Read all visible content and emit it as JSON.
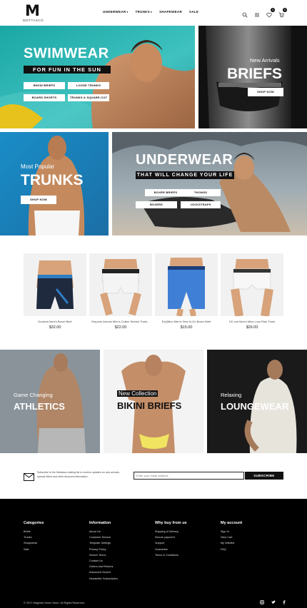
{
  "header": {
    "logo_mark": "M",
    "logo_name": "MOTTASCO",
    "nav": [
      {
        "label": "UNDERWEAR",
        "caret": "▾"
      },
      {
        "label": "TRUNKS",
        "caret": "▾"
      },
      {
        "label": "SHAPEWEAR",
        "caret": ""
      },
      {
        "label": "SALE",
        "caret": ""
      }
    ],
    "wishlist_count": "0",
    "cart_count": "0"
  },
  "banners": {
    "swimwear": {
      "title": "SWIMWEAR",
      "subtitle": "FOR FUN IN THE SUN",
      "buttons": [
        "BIKINI BRIEFS",
        "LOOSE TRUNKS",
        "BOARD SHORTS",
        "TRUNKS & SQUARE-CUT"
      ]
    },
    "briefs": {
      "kicker": "New Arrivals",
      "title": "BRIEFS",
      "button": "SHOP NOW"
    },
    "trunks": {
      "kicker": "Most Popular",
      "title": "TRUNKS",
      "button": "SHOP NOW"
    },
    "underwear": {
      "title": "UNDERWEAR",
      "subtitle": "THAT WILL CHANGE YOUR LIFE",
      "buttons": [
        "BOXER BRIEFS",
        "THONGS",
        "BOXERS",
        "JOCKSTRAPS"
      ]
    }
  },
  "products": [
    {
      "name": "Dockers Men's Boxer Brief",
      "price": "$32.00",
      "color": "#1f2a3f",
      "accent": "#2d7ec4"
    },
    {
      "name": "Emporio Armani Men's Cotton Stretch Trunk...",
      "price": "$22.00",
      "color": "#f4f4f4",
      "accent": "#222222"
    },
    {
      "name": "Ex()Mino Men's Give-N-Go Boxer Brief",
      "price": "$15.00",
      "color": "#3f7fd6",
      "accent": "#1b3f7a"
    },
    {
      "name": "CK one Men's Micro Low Rise Trunk",
      "price": "$26.00",
      "color": "#f7f7f7",
      "accent": "#333333"
    }
  ],
  "categories": {
    "athletics": {
      "kicker": "Game Changing",
      "title": "ATHLETICS"
    },
    "bikini": {
      "kicker": "New Collection",
      "title": "BIKINI BRIEFS"
    },
    "lounge": {
      "kicker": "Relaxing",
      "title": "LOUNGEWEAR"
    }
  },
  "newsletter": {
    "text": "Subscribe to the Mottasco mailing list to receive updates on new arrivals, special offers and other discount information.",
    "placeholder": "Enter your email address",
    "button": "SUBSCRIBE"
  },
  "footer": {
    "columns": [
      {
        "title": "Categories",
        "links": [
          "Briefs",
          "Trunks",
          "Shapewear",
          "Sale"
        ]
      },
      {
        "title": "Information",
        "links": [
          "About Us",
          "Customer Service",
          "Template Settings",
          "Privacy Policy",
          "Search Terms",
          "Contact Us",
          "Orders and Returns",
          "Advanced Search",
          "Newsletter Subscription"
        ]
      },
      {
        "title": "Why buy from us",
        "links": [
          "Shipping & Delivery",
          "Secure payment",
          "Support",
          "Guarantee",
          "Terms & Conditions"
        ]
      },
      {
        "title": "My account",
        "links": [
          "Sign In",
          "View Cart",
          "My Wishlist",
          "FAQ"
        ]
      }
    ],
    "copyright": "© 2017 Magento Demo Store. All Rights Reserved.",
    "social": [
      "instagram-icon",
      "twitter-icon",
      "facebook-icon"
    ]
  }
}
